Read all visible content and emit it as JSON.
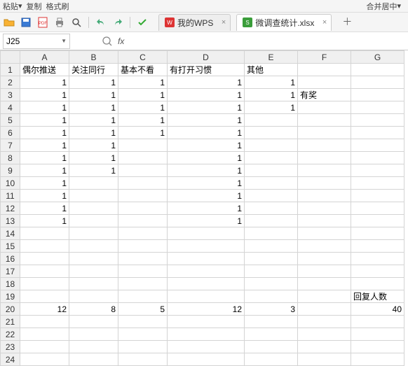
{
  "toolbar_top": {
    "paste_label": "粘贴",
    "copy_label": "复制",
    "format_painter_label": "格式刷",
    "merge_center_label": "合并居中"
  },
  "tabs": {
    "wps_label": "我的WPS",
    "file_label": "微调查统计.xlsx"
  },
  "name_box": {
    "value": "J25"
  },
  "formula": {
    "value": ""
  },
  "columns": [
    "A",
    "B",
    "C",
    "D",
    "E",
    "F",
    "G"
  ],
  "row_count": 24,
  "cells": {
    "A1": "偶尔推送",
    "B1": "关注同行",
    "C1": "基本不看",
    "D1": "有打开习惯",
    "E1": "其他",
    "A2": "1",
    "B2": "1",
    "C2": "1",
    "D2": "1",
    "E2": "1",
    "A3": "1",
    "B3": "1",
    "C3": "1",
    "D3": "1",
    "E3": "1",
    "F3": "有奖",
    "A4": "1",
    "B4": "1",
    "C4": "1",
    "D4": "1",
    "E4": "1",
    "A5": "1",
    "B5": "1",
    "C5": "1",
    "D5": "1",
    "A6": "1",
    "B6": "1",
    "C6": "1",
    "D6": "1",
    "A7": "1",
    "B7": "1",
    "D7": "1",
    "A8": "1",
    "B8": "1",
    "D8": "1",
    "A9": "1",
    "B9": "1",
    "D9": "1",
    "A10": "1",
    "D10": "1",
    "A11": "1",
    "D11": "1",
    "A12": "1",
    "D12": "1",
    "A13": "1",
    "D13": "1",
    "G19": "回复人数",
    "A20": "12",
    "B20": "8",
    "C20": "5",
    "D20": "12",
    "E20": "3",
    "G20": "40"
  },
  "numeric_cells": [
    "A2",
    "B2",
    "C2",
    "D2",
    "E2",
    "A3",
    "B3",
    "C3",
    "D3",
    "E3",
    "A4",
    "B4",
    "C4",
    "D4",
    "E4",
    "A5",
    "B5",
    "C5",
    "D5",
    "A6",
    "B6",
    "C6",
    "D6",
    "A7",
    "B7",
    "D7",
    "A8",
    "B8",
    "D8",
    "A9",
    "B9",
    "D9",
    "A10",
    "D10",
    "A11",
    "D11",
    "A12",
    "D12",
    "A13",
    "D13",
    "A20",
    "B20",
    "C20",
    "D20",
    "E20",
    "G20"
  ]
}
